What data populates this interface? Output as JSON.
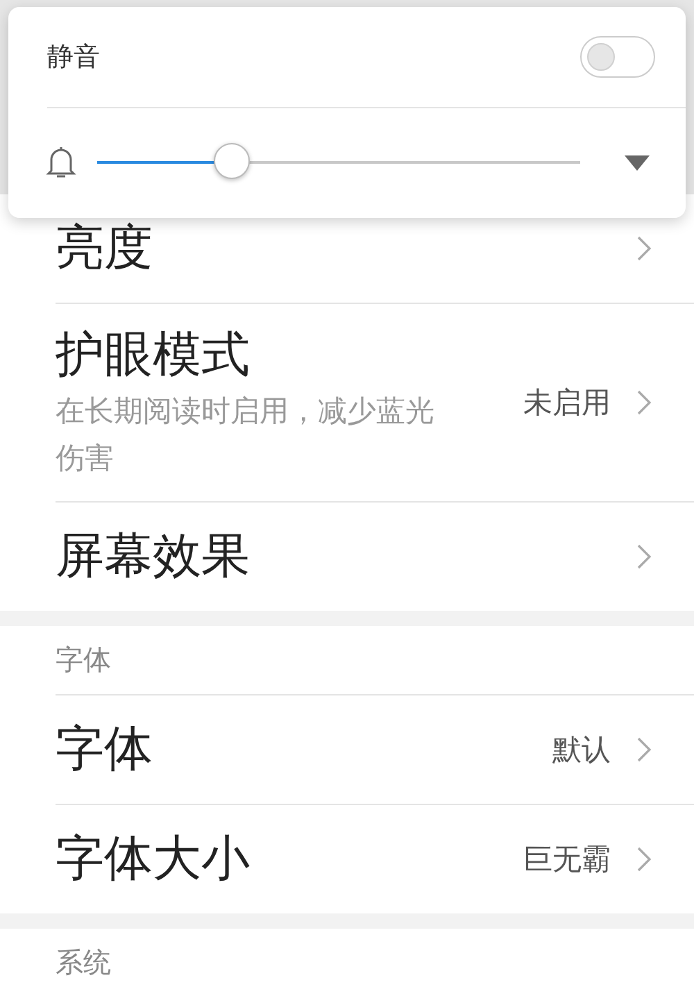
{
  "volume_panel": {
    "mute": {
      "label": "静音",
      "on": false
    },
    "volume": {
      "level": 0.28
    }
  },
  "sections": [
    {
      "items": [
        {
          "title": "亮度"
        },
        {
          "title": "护眼模式",
          "subtitle": "在长期阅读时启用，减少蓝光伤害",
          "value": "未启用"
        },
        {
          "title": "屏幕效果"
        }
      ]
    },
    {
      "header": "字体",
      "items": [
        {
          "title": "字体",
          "value": "默认"
        },
        {
          "title": "字体大小",
          "value": "巨无霸"
        }
      ]
    },
    {
      "header": "系统"
    }
  ]
}
